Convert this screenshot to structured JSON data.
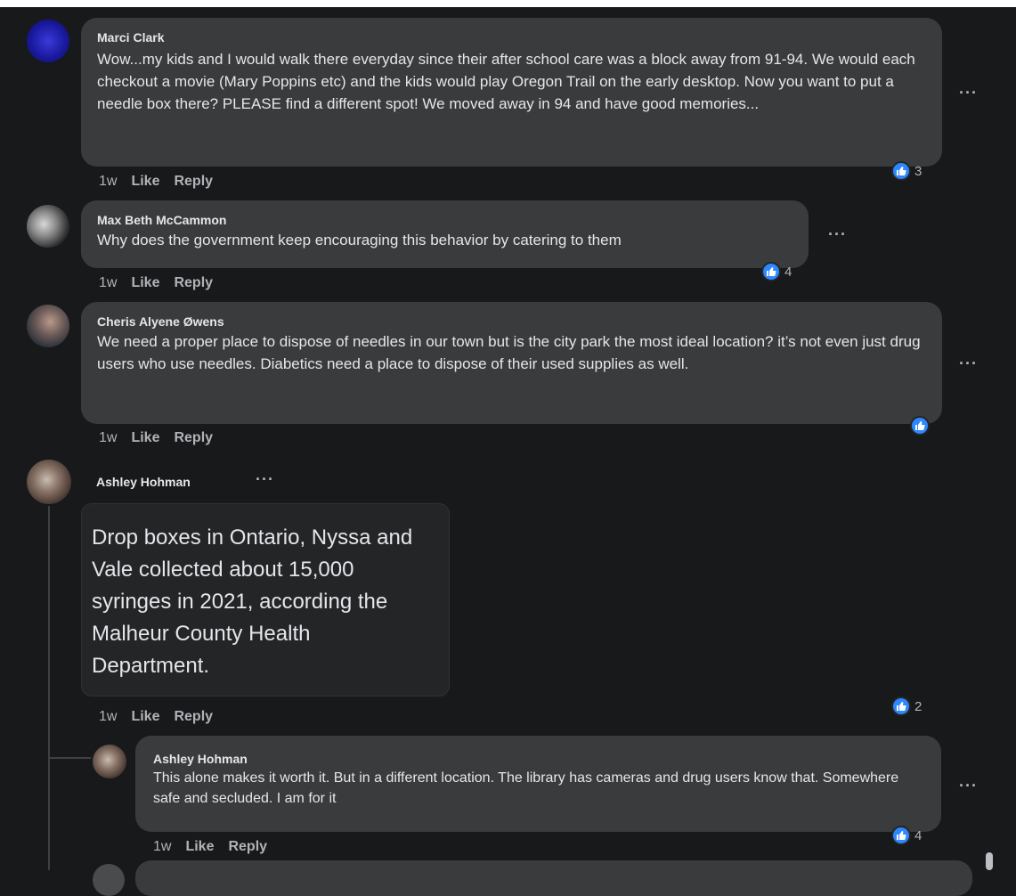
{
  "comments": [
    {
      "author": "Marci Clark",
      "text": "Wow...my kids and I would walk there everyday since their after school care was a block away from 91-94. We would each checkout a movie (Mary Poppins etc) and the kids would play Oregon Trail on the early desktop. Now you want to put a needle box there? PLEASE find a different spot! We moved away in 94 and have good memories...",
      "time": "1w",
      "like": "Like",
      "reply": "Reply",
      "reactions": "3"
    },
    {
      "author": "Max Beth McCammon",
      "text": "Why does the government keep encouraging this behavior by catering to them",
      "time": "1w",
      "like": "Like",
      "reply": "Reply",
      "reactions": "4"
    },
    {
      "author": "Cheris Alyene Øwens",
      "text": "We need a proper place to dispose of needles in our town but is the city park the most ideal location? it’s not even just drug users who use needles. Diabetics need a place to dispose of their used supplies as well.",
      "time": "1w",
      "like": "Like",
      "reply": "Reply",
      "reactions": ""
    },
    {
      "author": "Ashley Hohman",
      "text": "Drop boxes in Ontario, Nyssa and Vale collected about 15,000 syringes in 2021, according the Malheur County Health Department.",
      "time": "1w",
      "like": "Like",
      "reply": "Reply",
      "reactions": "2"
    }
  ],
  "reply": {
    "author": "Ashley Hohman",
    "text": "This alone makes it worth it. But in a different location. The library has cameras and drug users know that. Somewhere safe and secluded. I am for it",
    "time": "1w",
    "like": "Like",
    "reply": "Reply",
    "reactions": "4"
  },
  "more_options": "···",
  "colors": {
    "like_blue": "#2d88ff",
    "bubble": "#3a3b3c",
    "background": "#18191a"
  }
}
